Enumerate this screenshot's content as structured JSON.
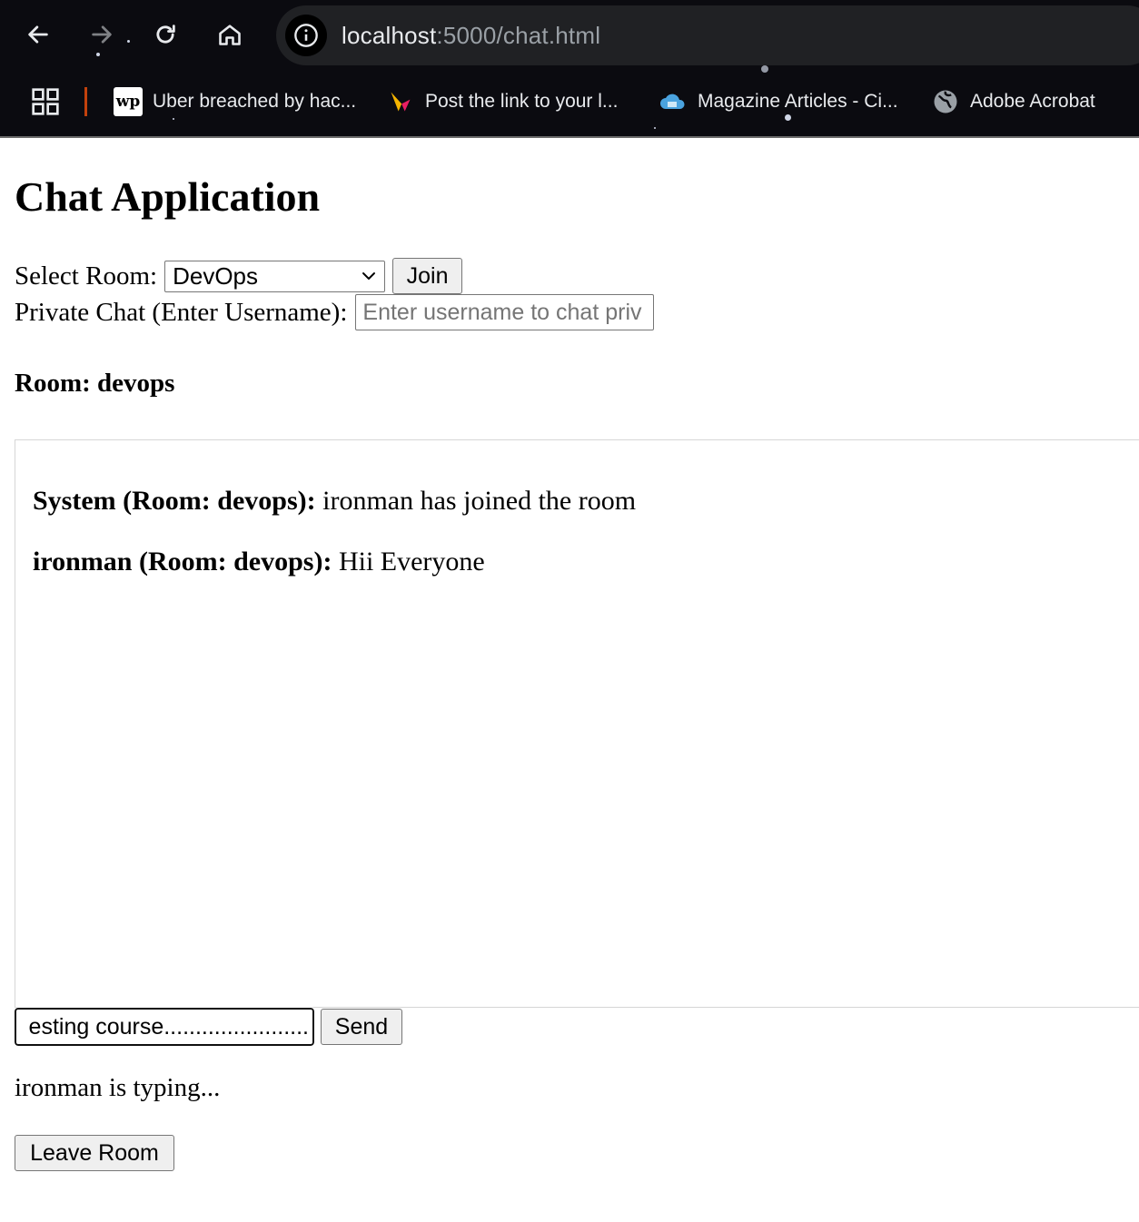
{
  "browser": {
    "url_host": "localhost",
    "url_path": ":5000/chat.html",
    "bookmarks": [
      {
        "label": "Uber breached by hac...",
        "icon": "washington-post-icon"
      },
      {
        "label": "Post the link to your l...",
        "icon": "bookmark-logo-icon"
      },
      {
        "label": "Magazine Articles - Ci...",
        "icon": "cloud-icon"
      },
      {
        "label": "Adobe Acrobat",
        "icon": "globe-icon"
      }
    ]
  },
  "page": {
    "title": "Chat Application",
    "select_room_label": "Select Room:",
    "selected_room": "DevOps",
    "join_label": "Join",
    "private_chat_label": "Private Chat (Enter Username):",
    "private_chat_placeholder": "Enter username to chat priv",
    "room_heading": "Room: devops",
    "messages": [
      {
        "sender": "System (Room: devops):",
        "text": "ironman has joined the room"
      },
      {
        "sender": "ironman (Room: devops):",
        "text": "Hii Everyone"
      }
    ],
    "message_input_value": "esting course.......................",
    "send_label": "Send",
    "typing_status": "ironman is typing...",
    "leave_label": "Leave Room"
  },
  "colors": {
    "chrome_bg": "#0b0b10",
    "urlbar_bg": "#202124",
    "button_bg": "#efefef"
  }
}
